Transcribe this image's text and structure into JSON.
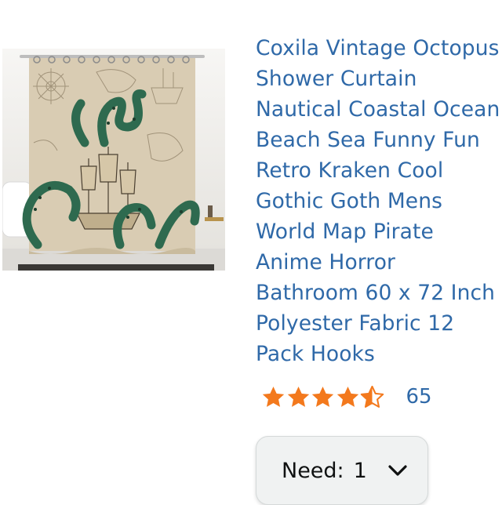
{
  "product": {
    "title": "Coxila Vintage Octopus Shower Curtain Nautical Coastal Ocean Beach Sea Funny Fun Retro Kraken Cool Gothic Goth Mens World Map Pirate Anime Horror Bathroom 60 x 72 Inch Polyester Fabric 12 Pack Hooks",
    "image_alt": "Vintage octopus kraken nautical map shower curtain"
  },
  "rating": {
    "stars": 4.5,
    "max_stars": 5,
    "count": "65",
    "star_color": "#f3791d"
  },
  "quantity": {
    "label": "Need:",
    "value": "1",
    "chevron_icon": "chevron-down-icon"
  },
  "colors": {
    "link": "#2f69a8",
    "curtain": "#d9ccb3",
    "tentacle": "#2e6a4f"
  }
}
